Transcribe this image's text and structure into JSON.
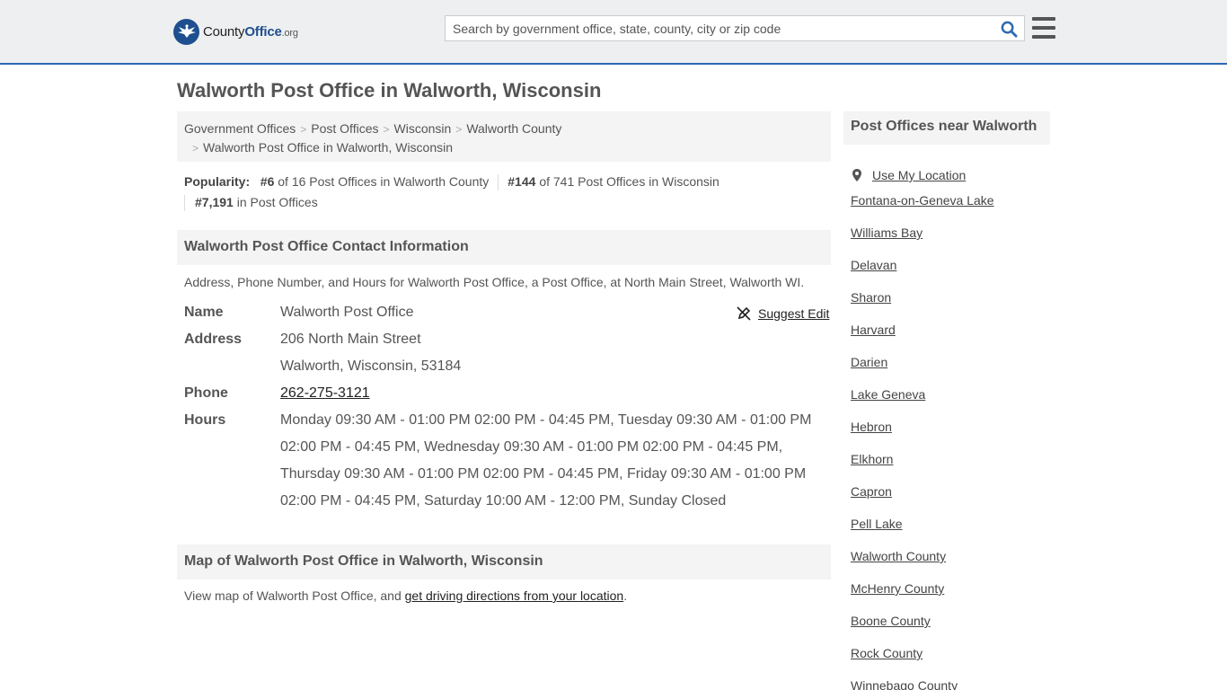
{
  "header": {
    "logo_main": "County",
    "logo_bold": "Office",
    "logo_suffix": ".org",
    "search_placeholder": "Search by government office, state, county, city or zip code"
  },
  "page_title": "Walworth Post Office in Walworth, Wisconsin",
  "breadcrumb": {
    "items": [
      "Government Offices",
      "Post Offices",
      "Wisconsin",
      "Walworth County"
    ],
    "current": "Walworth Post Office in Walworth, Wisconsin"
  },
  "popularity": {
    "label": "Popularity:",
    "rank1": "#6",
    "rank1_text": "of 16 Post Offices in Walworth County",
    "rank2": "#144",
    "rank2_text": "of 741 Post Offices in Wisconsin",
    "rank3": "#7,191",
    "rank3_text": "in Post Offices"
  },
  "contact": {
    "heading": "Walworth Post Office Contact Information",
    "description": "Address, Phone Number, and Hours for Walworth Post Office, a Post Office, at North Main Street, Walworth WI.",
    "suggest_edit": "Suggest Edit",
    "name_label": "Name",
    "name_value": "Walworth Post Office",
    "address_label": "Address",
    "address_line1": "206 North Main Street",
    "address_line2": "Walworth, Wisconsin, 53184",
    "phone_label": "Phone",
    "phone_value": "262-275-3121",
    "hours_label": "Hours",
    "hours_value": "Monday 09:30 AM - 01:00 PM 02:00 PM - 04:45 PM, Tuesday 09:30 AM - 01:00 PM 02:00 PM - 04:45 PM, Wednesday 09:30 AM - 01:00 PM 02:00 PM - 04:45 PM, Thursday 09:30 AM - 01:00 PM 02:00 PM - 04:45 PM, Friday 09:30 AM - 01:00 PM 02:00 PM - 04:45 PM, Saturday 10:00 AM - 12:00 PM, Sunday Closed"
  },
  "map": {
    "heading": "Map of Walworth Post Office in Walworth, Wisconsin",
    "description_prefix": "View map of Walworth Post Office, and ",
    "directions_link": "get driving directions from your location",
    "description_suffix": "."
  },
  "sidebar": {
    "heading": "Post Offices near Walworth",
    "use_location": "Use My Location",
    "items": [
      "Fontana-on-Geneva Lake",
      "Williams Bay",
      "Delavan",
      "Sharon",
      "Harvard",
      "Darien",
      "Lake Geneva",
      "Hebron",
      "Elkhorn",
      "Capron",
      "Pell Lake",
      "Walworth County",
      "McHenry County",
      "Boone County",
      "Rock County",
      "Winnebago County"
    ]
  },
  "colors": {
    "brand_blue": "#1e4f8f",
    "header_border": "#2d6ab3",
    "header_bg": "#eeeff0",
    "panel_bg": "#f4f4f5"
  }
}
